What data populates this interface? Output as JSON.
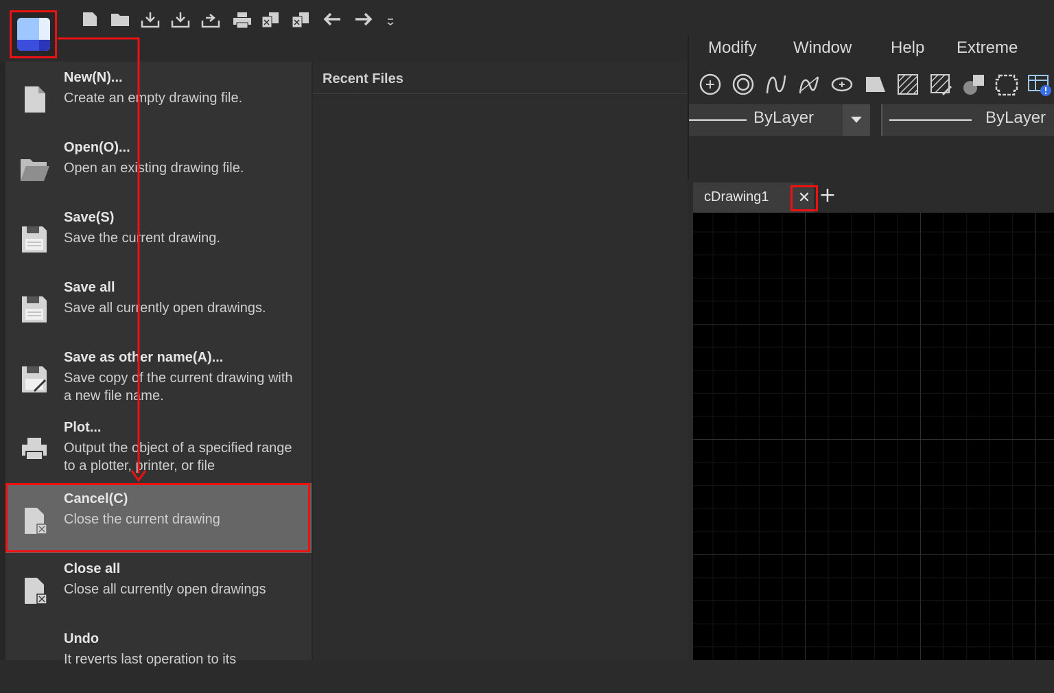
{
  "ribbon": {
    "menus": [
      "Modify",
      "Window",
      "Help",
      "Extreme"
    ],
    "linetype_1": "ByLayer",
    "linetype_2": "ByLayer"
  },
  "document_tab": {
    "title": "cDrawing1"
  },
  "app_menu": {
    "items": [
      {
        "title": "New(N)...",
        "desc": "Create an empty drawing file."
      },
      {
        "title": "Open(O)...",
        "desc": "Open an existing drawing file."
      },
      {
        "title": "Save(S)",
        "desc": "Save the current drawing."
      },
      {
        "title": "Save all",
        "desc": "Save all currently open drawings."
      },
      {
        "title": "Save as other name(A)...",
        "desc": "Save copy of the current drawing with a new file name."
      },
      {
        "title": "Plot...",
        "desc": "Output the object of a specified range to a plotter, printer, or file"
      },
      {
        "title": "Cancel(C)",
        "desc": "Close the current drawing"
      },
      {
        "title": "Close all",
        "desc": "Close all currently open drawings"
      },
      {
        "title": "Undo",
        "desc": "It reverts last operation to its"
      }
    ]
  },
  "recent_files": {
    "header": "Recent Files"
  },
  "colors": {
    "highlight": "#ee1111",
    "selected_item": "#666666",
    "canvas": "#000000"
  }
}
